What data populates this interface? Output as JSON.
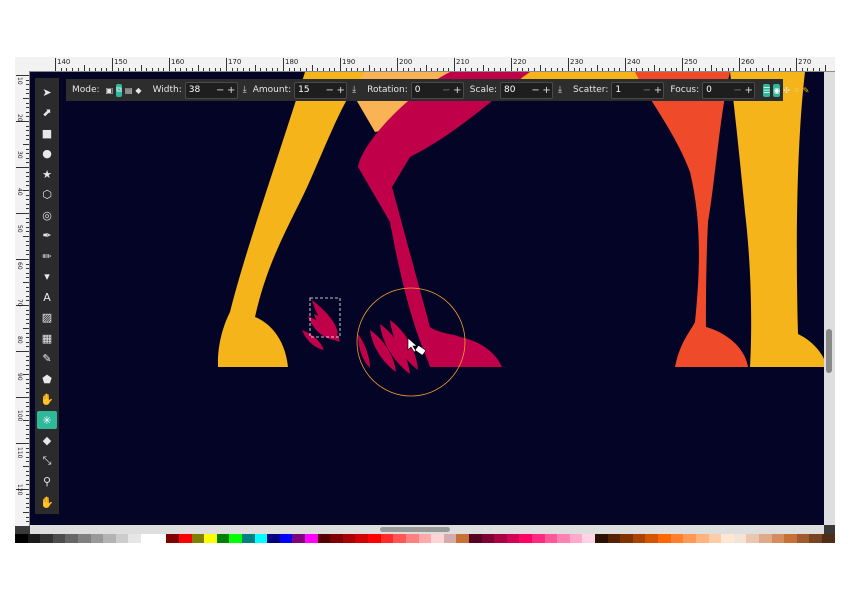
{
  "ruler": {
    "top_labels": [
      "140",
      "150",
      "160",
      "170",
      "180",
      "190",
      "200",
      "210",
      "220",
      "230",
      "240",
      "250",
      "260",
      "270"
    ],
    "left_labels": [
      "10",
      "20",
      "30",
      "40",
      "50",
      "60",
      "70",
      "80",
      "90",
      "100",
      "110",
      "120"
    ]
  },
  "toolbox": {
    "tools": [
      {
        "name": "selector-tool-icon",
        "glyph": "➤"
      },
      {
        "name": "node-tool-icon",
        "glyph": "⬈"
      },
      {
        "name": "rect-tool-icon",
        "glyph": "■"
      },
      {
        "name": "ellipse-tool-icon",
        "glyph": "●"
      },
      {
        "name": "star-tool-icon",
        "glyph": "★"
      },
      {
        "name": "box3d-tool-icon",
        "glyph": "⬡"
      },
      {
        "name": "spiral-tool-icon",
        "glyph": "◎"
      },
      {
        "name": "pen-tool-icon",
        "glyph": "✒"
      },
      {
        "name": "pencil-tool-icon",
        "glyph": "✏"
      },
      {
        "name": "calligraphy-tool-icon",
        "glyph": "▾"
      },
      {
        "name": "text-tool-icon",
        "glyph": "A"
      },
      {
        "name": "gradient-tool-icon",
        "glyph": "▨"
      },
      {
        "name": "mesh-tool-icon",
        "glyph": "▦"
      },
      {
        "name": "dropper-tool-icon",
        "glyph": "✎"
      },
      {
        "name": "paintbucket-tool-icon",
        "glyph": "⬟"
      },
      {
        "name": "tweak-tool-icon",
        "glyph": "✋"
      },
      {
        "name": "spray-tool-icon",
        "glyph": "✳"
      },
      {
        "name": "eraser-tool-icon",
        "glyph": "◆"
      },
      {
        "name": "connector-tool-icon",
        "glyph": "⤡"
      },
      {
        "name": "zoom-tool-icon",
        "glyph": "⚲"
      },
      {
        "name": "pan-tool-icon",
        "glyph": "✋"
      }
    ],
    "active_index": 16
  },
  "controls": {
    "mode_label": "Mode:",
    "width_label": "Width:",
    "width_value": "38",
    "amount_label": "Amount:",
    "amount_value": "15",
    "rotation_label": "Rotation:",
    "rotation_value": "0",
    "scale_label": "Scale:",
    "scale_value": "80",
    "scatter_label": "Scatter:",
    "scatter_value": "1",
    "focus_label": "Focus:",
    "focus_value": "0",
    "minus": "−",
    "plus": "+"
  },
  "colors": {
    "canvas_bg": "#030426",
    "yellow": "#f4b41a",
    "light_orange": "#f9b354",
    "crimson": "#c1004a",
    "red_orange": "#ef4a2a",
    "accent": "#2fb99a"
  },
  "palette": [
    "#000000",
    "#1a1a1a",
    "#333333",
    "#4d4d4d",
    "#666666",
    "#808080",
    "#999999",
    "#b3b3b3",
    "#cccccc",
    "#e6e6e6",
    "#ffffff",
    "#ffffff",
    "#800000",
    "#ff0000",
    "#808000",
    "#ffff00",
    "#008000",
    "#00ff00",
    "#008080",
    "#00ffff",
    "#000080",
    "#0000ff",
    "#800080",
    "#ff00ff",
    "#550000",
    "#800000",
    "#aa0000",
    "#d40000",
    "#ff0000",
    "#ff2a2a",
    "#ff5555",
    "#ff8080",
    "#ffaaaa",
    "#ffd5d5",
    "#d4aaaa",
    "#c87137",
    "#550022",
    "#800033",
    "#aa0044",
    "#d40055",
    "#ff0066",
    "#ff2a7f",
    "#ff5599",
    "#ff80b2",
    "#ffaacc",
    "#ffd5e5",
    "#2b1100",
    "#552200",
    "#803300",
    "#aa4400",
    "#d45500",
    "#ff6600",
    "#ff7f2a",
    "#ff9955",
    "#ffb380",
    "#ffccaa",
    "#ffe6d5",
    "#f4e3d7",
    "#e9c6af",
    "#deaa87",
    "#d38d5f",
    "#c87137",
    "#a05a2c",
    "#784421",
    "#502d16"
  ]
}
